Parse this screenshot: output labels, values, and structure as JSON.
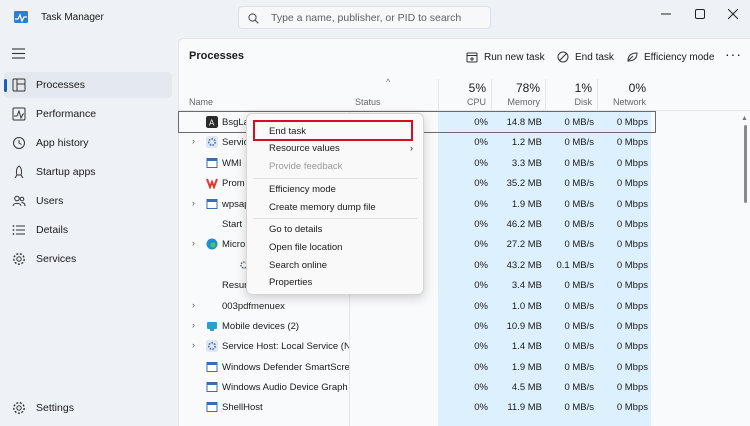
{
  "window": {
    "title": "Task Manager"
  },
  "search": {
    "placeholder": "Type a name, publisher, or PID to search"
  },
  "sidebar": {
    "items": [
      {
        "label": "Processes",
        "icon": "processes-icon"
      },
      {
        "label": "Performance",
        "icon": "performance-icon"
      },
      {
        "label": "App history",
        "icon": "app-history-icon"
      },
      {
        "label": "Startup apps",
        "icon": "startup-apps-icon"
      },
      {
        "label": "Users",
        "icon": "users-icon"
      },
      {
        "label": "Details",
        "icon": "details-icon"
      },
      {
        "label": "Services",
        "icon": "services-icon"
      }
    ],
    "settings_label": "Settings"
  },
  "main": {
    "title": "Processes",
    "toolbar": {
      "run_new_task": "Run new task",
      "end_task": "End task",
      "efficiency_mode": "Efficiency mode",
      "more": "···"
    },
    "columns": {
      "name": "Name",
      "status": "Status",
      "cpu": {
        "pct": "5%",
        "label": "CPU"
      },
      "memory": {
        "pct": "78%",
        "label": "Memory"
      },
      "disk": {
        "pct": "1%",
        "label": "Disk"
      },
      "network": {
        "pct": "0%",
        "label": "Network"
      }
    },
    "rows": [
      {
        "name": "BsgLa",
        "expand": "",
        "cpu": "0%",
        "mem": "14.8 MB",
        "disk": "0 MB/s",
        "net": "0 Mbps"
      },
      {
        "name": "Servic",
        "expand": "›",
        "cpu": "0%",
        "mem": "1.2 MB",
        "disk": "0 MB/s",
        "net": "0 Mbps"
      },
      {
        "name": "WMI",
        "expand": "",
        "cpu": "0%",
        "mem": "3.3 MB",
        "disk": "0 MB/s",
        "net": "0 Mbps"
      },
      {
        "name": "Prom",
        "expand": "",
        "cpu": "0%",
        "mem": "35.2 MB",
        "disk": "0 MB/s",
        "net": "0 Mbps"
      },
      {
        "name": "wpsap",
        "expand": "›",
        "cpu": "0%",
        "mem": "1.9 MB",
        "disk": "0 MB/s",
        "net": "0 Mbps"
      },
      {
        "name": "Start",
        "expand": "",
        "cpu": "0%",
        "mem": "46.2 MB",
        "disk": "0 MB/s",
        "net": "0 Mbps"
      },
      {
        "name": "Micro",
        "expand": "›",
        "cpu": "0%",
        "mem": "27.2 MB",
        "disk": "0 MB/s",
        "net": "0 Mbps"
      },
      {
        "name": "",
        "expand": "",
        "cpu": "0%",
        "mem": "43.2 MB",
        "disk": "0.1 MB/s",
        "net": "0 Mbps"
      },
      {
        "name": "Resur",
        "expand": "",
        "cpu": "0%",
        "mem": "3.4 MB",
        "disk": "0 MB/s",
        "net": "0 Mbps"
      },
      {
        "name": "003pdfmenuex",
        "expand": "›",
        "cpu": "0%",
        "mem": "1.0 MB",
        "disk": "0 MB/s",
        "net": "0 Mbps"
      },
      {
        "name": "Mobile devices (2)",
        "expand": "›",
        "cpu": "0%",
        "mem": "10.9 MB",
        "disk": "0 MB/s",
        "net": "0 Mbps"
      },
      {
        "name": "Service Host: Local Service (N...",
        "expand": "›",
        "cpu": "0%",
        "mem": "1.4 MB",
        "disk": "0 MB/s",
        "net": "0 Mbps"
      },
      {
        "name": "Windows Defender SmartScreen",
        "expand": "",
        "cpu": "0%",
        "mem": "1.9 MB",
        "disk": "0 MB/s",
        "net": "0 Mbps"
      },
      {
        "name": "Windows Audio Device Graph ...",
        "expand": "",
        "cpu": "0%",
        "mem": "4.5 MB",
        "disk": "0 MB/s",
        "net": "0 Mbps"
      },
      {
        "name": "ShellHost",
        "expand": "",
        "cpu": "0%",
        "mem": "11.9 MB",
        "disk": "0 MB/s",
        "net": "0 Mbps"
      }
    ]
  },
  "context_menu": {
    "end_task": "End task",
    "resource_values": "Resource values",
    "provide_feedback": "Provide feedback",
    "efficiency_mode": "Efficiency mode",
    "create_dump": "Create memory dump file",
    "go_to_details": "Go to details",
    "open_file_location": "Open file location",
    "search_online": "Search online",
    "properties": "Properties"
  },
  "colors": {
    "accent": "#1a5fb4",
    "highlight": "#d40f1f",
    "column_shade": "#ddf0fd"
  }
}
